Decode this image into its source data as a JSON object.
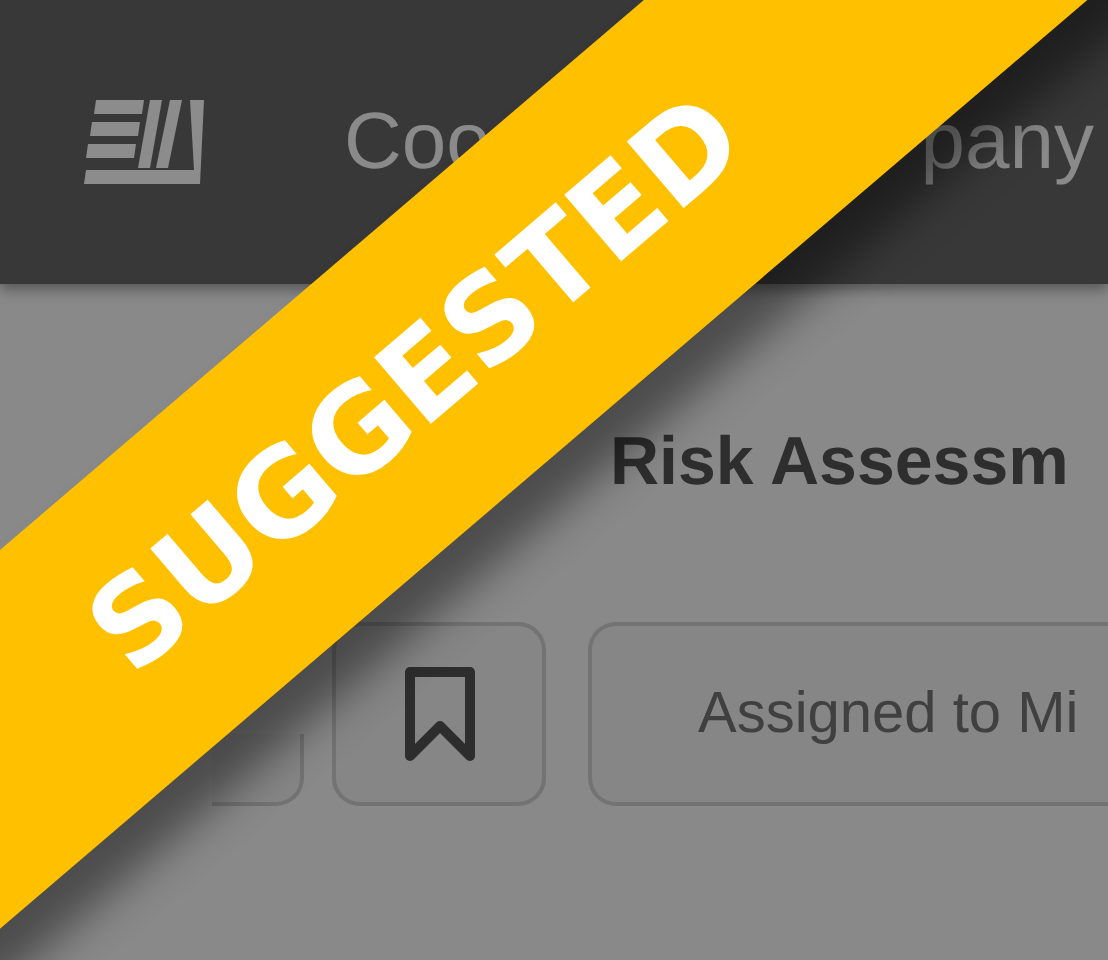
{
  "header": {
    "title_parts": [
      "Coo",
      "pany"
    ]
  },
  "page": {
    "title": "Risk Assessm"
  },
  "actions": [
    {
      "kind": "icon"
    },
    {
      "kind": "bookmark"
    },
    {
      "kind": "text",
      "label": "Assigned to Mi"
    }
  ],
  "ribbon": {
    "label": "SUGGESTED"
  }
}
